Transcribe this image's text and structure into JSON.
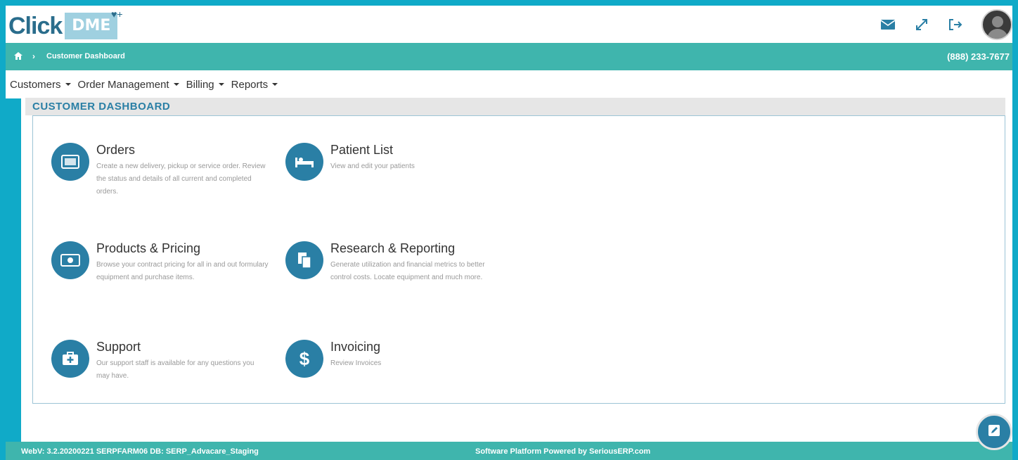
{
  "brand": {
    "logo_click": "Click",
    "logo_dme": "DME",
    "logo_mark": "♥+"
  },
  "header": {
    "icons": [
      "mail-icon",
      "expand-icon",
      "sign-out-icon"
    ]
  },
  "breadcrumb": {
    "separator": "›",
    "current": "Customer Dashboard"
  },
  "phone": "(888) 233-7677",
  "nav": {
    "items": [
      {
        "label": "Customers"
      },
      {
        "label": "Order Management"
      },
      {
        "label": "Billing"
      },
      {
        "label": "Reports"
      }
    ]
  },
  "panel": {
    "title": "CUSTOMER DASHBOARD"
  },
  "tiles": {
    "orders": {
      "title": "Orders",
      "desc": "Create a new delivery, pickup or service order. Review the status and details of all current and completed orders."
    },
    "patient_list": {
      "title": "Patient List",
      "desc": "View and edit your patients"
    },
    "products": {
      "title": "Products & Pricing",
      "desc": "Browse your contract pricing for all in and out formulary equipment and purchase items."
    },
    "research": {
      "title": "Research & Reporting",
      "desc": "Generate utilization and financial metrics to better control costs. Locate equipment and much more."
    },
    "support": {
      "title": "Support",
      "desc": "Our support staff is available for any questions you may have."
    },
    "invoicing": {
      "title": "Invoicing",
      "desc": "Review Invoices"
    }
  },
  "footer": {
    "left": "WebV: 3.2.20200221 SERPFARM06 DB: SERP_Advacare_Staging",
    "center": "Software Platform Powered by SeriousERP.com"
  },
  "colors": {
    "accent": "#2a7fa5",
    "teal": "#3fb5ad",
    "border": "#10aac8"
  }
}
